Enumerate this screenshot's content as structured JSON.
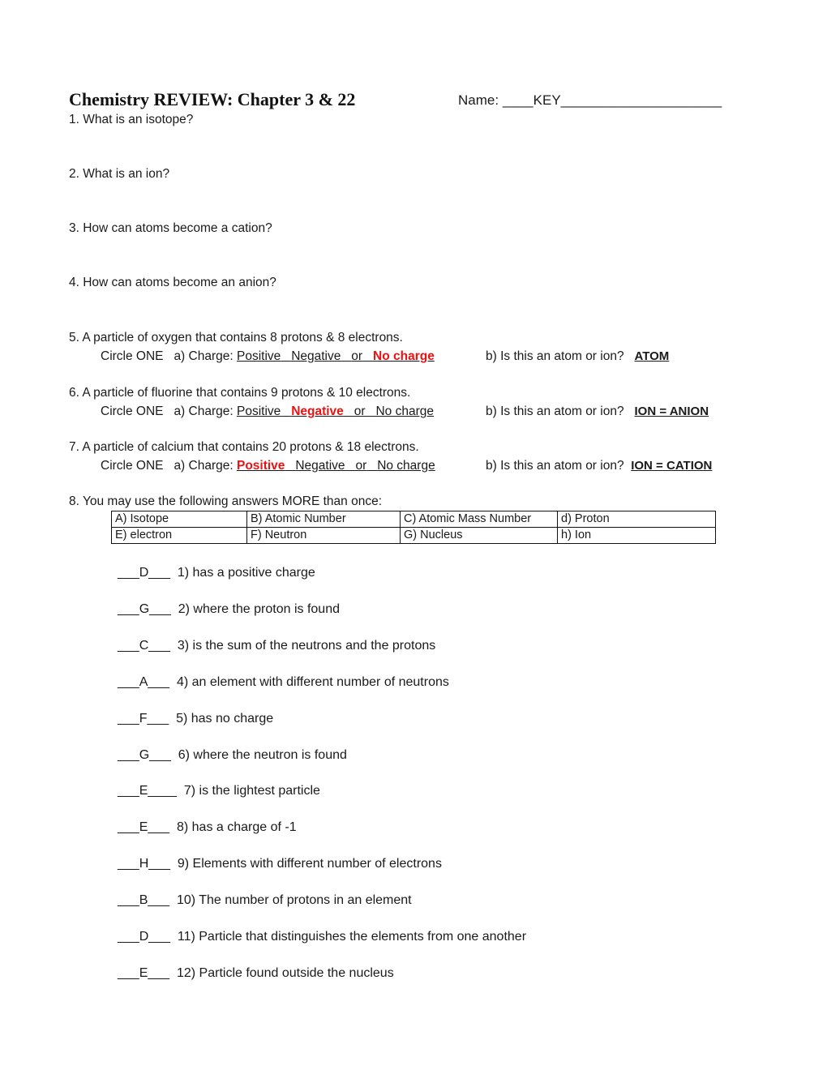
{
  "header": {
    "title": "Chemistry REVIEW: Chapter 3 & 22",
    "name_label": "Name:",
    "name_prefix": "____",
    "name_value": "KEY",
    "name_suffix": "_____________________"
  },
  "questions": [
    {
      "text": "1. What is an isotope?"
    },
    {
      "text": "2. What is an ion?"
    },
    {
      "text": "3. How can atoms become a cation?"
    },
    {
      "text": "4. How can atoms become an anion?"
    }
  ],
  "particle_questions": [
    {
      "text": "5. A particle of oxygen that contains 8 protons & 8 electrons.",
      "circle_label": "Circle ONE",
      "part_a": "a)  Charge:",
      "options": [
        "Positive",
        "Negative",
        "or",
        "No charge"
      ],
      "selected": "No charge",
      "part_b": "b) Is this an atom or ion?",
      "answer_b": "ATOM"
    },
    {
      "text": "6. A particle of fluorine that contains 9 protons & 10 electrons.",
      "circle_label": "Circle ONE",
      "part_a": "a)  Charge:",
      "options": [
        "Positive",
        "Negative",
        "or",
        "No charge"
      ],
      "selected": "Negative",
      "part_b": "b) Is this an atom or ion?",
      "answer_b": "ION = ANION"
    },
    {
      "text": "7. A particle of calcium that contains 20 protons & 18 electrons.",
      "circle_label": "Circle ONE",
      "part_a": "a)  Charge:",
      "options": [
        "Positive",
        "Negative",
        "or",
        "No charge"
      ],
      "selected": "Positive",
      "part_b": "b) Is this an atom or ion?",
      "answer_b": "ION = CATION"
    }
  ],
  "matching": {
    "instruction": "8. You may use the following answers MORE than once:",
    "table": [
      [
        "A) Isotope",
        "B) Atomic Number",
        "C) Atomic Mass Number",
        "d) Proton"
      ],
      [
        "E) electron",
        "F) Neutron",
        "G) Nucleus",
        "h)  Ion"
      ]
    ],
    "items": [
      {
        "answer": "D",
        "text": "1) has a positive charge"
      },
      {
        "answer": "G",
        "text": "2) where the proton is found"
      },
      {
        "answer": "C",
        "text": "3) is the sum of the neutrons and the protons"
      },
      {
        "answer": "A",
        "text": "4) an element with different number of neutrons"
      },
      {
        "answer": "F",
        "text": "5) has no charge"
      },
      {
        "answer": "G",
        "text": "6) where the neutron is found"
      },
      {
        "answer": "E",
        "text": "7) is the lightest particle"
      },
      {
        "answer": "E",
        "text": "8) has a charge of -1"
      },
      {
        "answer": "H",
        "text": "9) Elements with different number of electrons"
      },
      {
        "answer": "B",
        "text": "10) The number of protons in an element"
      },
      {
        "answer": "D",
        "text": "11) Particle that distinguishes the elements from one another"
      },
      {
        "answer": "E",
        "text": "12) Particle found outside the nucleus"
      }
    ]
  },
  "colors": {
    "highlight": "#ee1111",
    "text": "#1a1a1a"
  }
}
